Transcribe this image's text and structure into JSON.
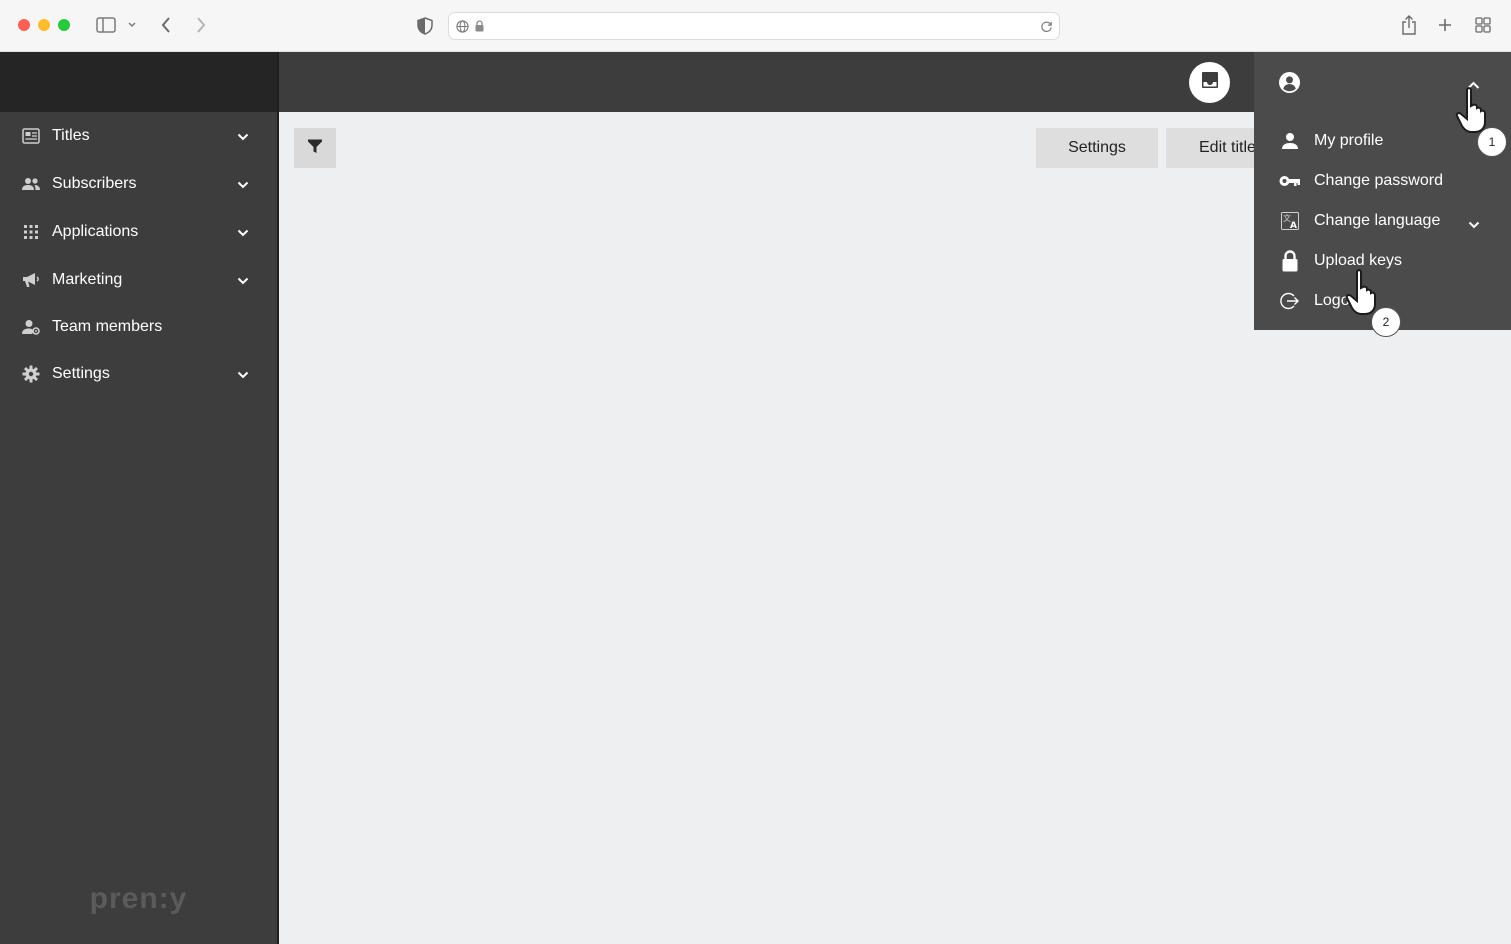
{
  "browser": {
    "url": ""
  },
  "sidebar": {
    "items": [
      {
        "label": "Titles",
        "icon": "newspaper-icon",
        "expandable": true
      },
      {
        "label": "Subscribers",
        "icon": "people-icon",
        "expandable": true
      },
      {
        "label": "Applications",
        "icon": "apps-grid-icon",
        "expandable": true
      },
      {
        "label": "Marketing",
        "icon": "megaphone-icon",
        "expandable": true
      },
      {
        "label": "Team members",
        "icon": "team-icon",
        "expandable": false
      },
      {
        "label": "Settings",
        "icon": "gear-icon",
        "expandable": true
      }
    ],
    "logo_text": "pren:y"
  },
  "toolbar": {
    "settings_label": "Settings",
    "edit_title_label": "Edit title"
  },
  "user_menu": {
    "items": [
      {
        "label": "My profile",
        "icon": "person-icon"
      },
      {
        "label": "Change password",
        "icon": "key-icon"
      },
      {
        "label": "Change language",
        "icon": "translate-icon"
      },
      {
        "label": "Upload keys",
        "icon": "lock-icon"
      },
      {
        "label": "Logout",
        "icon": "logout-icon"
      }
    ]
  },
  "annotations": {
    "step1": "1",
    "step2": "2"
  },
  "colors": {
    "sidebar_bg": "#3d3d3d",
    "topbar_bg": "#3d3d3d",
    "menu_bg": "#4b4b4b",
    "content_bg": "#eeeff0"
  }
}
